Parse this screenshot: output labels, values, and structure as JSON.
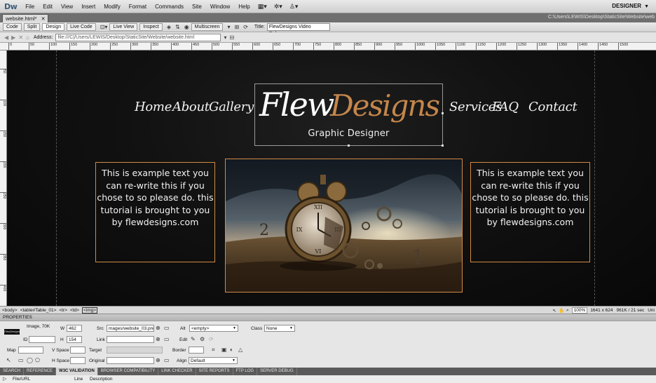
{
  "app": {
    "logo": "Dw",
    "menu": [
      "File",
      "Edit",
      "View",
      "Insert",
      "Modify",
      "Format",
      "Commands",
      "Site",
      "Window",
      "Help"
    ],
    "tool_icons": [
      "layout-icon",
      "gear-icon",
      "user-icon"
    ],
    "workspace": "DESIGNER"
  },
  "document": {
    "tab_label": "website.html*",
    "path": "C:\\Users\\LEWIS\\Desktop\\StaticSite\\Website\\web",
    "view_buttons": [
      "Code",
      "Split",
      "Design"
    ],
    "live_code": "Live Code",
    "live_view": "Live View",
    "inspect": "Inspect",
    "multiscreen": "Multiscreen",
    "title_label": "Title:",
    "title_value": "FlewDesigns Video Release",
    "address_label": "Address:",
    "address_value": "file:///C|/Users/LEWIS/Desktop/StaticSite/Website/website.html"
  },
  "ruler": {
    "marks": [
      "0",
      "50",
      "100",
      "150",
      "200",
      "250",
      "300",
      "350",
      "400",
      "450",
      "500",
      "550",
      "600",
      "650",
      "700",
      "750",
      "800",
      "850",
      "900",
      "950",
      "1000",
      "1050",
      "1100",
      "1150",
      "1200",
      "1250",
      "1300",
      "1350",
      "1400",
      "1450",
      "1500"
    ],
    "left_marks": [
      "50",
      "100",
      "150",
      "200",
      "250",
      "300",
      "350",
      "400"
    ]
  },
  "page": {
    "nav_left": [
      "Home",
      "About",
      "Gallery"
    ],
    "nav_right": [
      "Services",
      "FAQ",
      "Contact"
    ],
    "logo_word1": "Flew",
    "logo_word2": "Designs",
    "logo_subtitle": "Graphic Designer",
    "left_text": "This is example text you can re-write this if you chose to so please do. this tutorial is brought to you by flewdesigns.com",
    "right_text": "This is example text you can re-write this if you chose to so please do. this tutorial is brought to you by flewdesigns.com",
    "accent_color": "#d28b45"
  },
  "status": {
    "tags": [
      "<body>",
      "<table#Table_01>",
      "<tr>",
      "<td>",
      "<img>"
    ],
    "zoom": "100%",
    "dimensions": "1641 x 624",
    "download": "961K / 21 sec",
    "encoding": "Uni"
  },
  "properties": {
    "header": "PROPERTIES",
    "image_label": "Image, 70K",
    "thumb_text": "FlewDesigns",
    "id_label": "ID",
    "id_value": "",
    "w_label": "W",
    "w_value": "462",
    "h_label": "H",
    "h_value": "154",
    "src_label": "Src",
    "src_value": "mages/website_03.png",
    "link_label": "Link",
    "link_value": "",
    "alt_label": "Alt",
    "alt_value": "<empty>",
    "class_label": "Class",
    "class_value": "None",
    "edit_label": "Edit",
    "map_label": "Map",
    "map_value": "",
    "vspace_label": "V Space",
    "hspace_label": "H Space",
    "target_label": "Target",
    "original_label": "Original",
    "border_label": "Border",
    "align_label": "Align",
    "align_value": "Default"
  },
  "results": {
    "tabs": [
      "SEARCH",
      "REFERENCE",
      "W3C VALIDATION",
      "BROWSER COMPATIBILITY",
      "LINK CHECKER",
      "SITE REPORTS",
      "FTP LOG",
      "SERVER DEBUG"
    ],
    "active_tab": "W3C VALIDATION",
    "col_file": "File/URL",
    "col_line": "Line",
    "col_desc": "Description"
  }
}
